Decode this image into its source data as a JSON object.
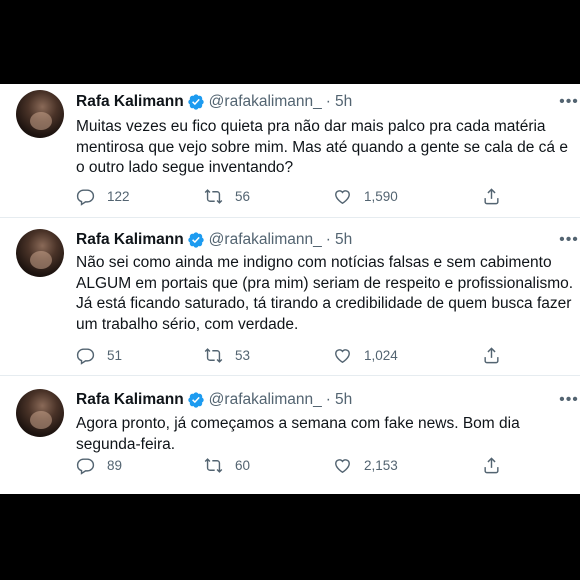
{
  "tweets": [
    {
      "name": "Rafa Kalimann",
      "handle": "@rafakalimann_",
      "sep": "·",
      "time": "5h",
      "text": "Muitas vezes eu fico quieta pra não dar mais palco pra cada matéria mentirosa que vejo sobre mim. Mas até quando a gente se cala de cá e o outro lado segue inventando?",
      "replies": "122",
      "retweets": "56",
      "likes": "1,590"
    },
    {
      "name": "Rafa Kalimann",
      "handle": "@rafakalimann_",
      "sep": "·",
      "time": "5h",
      "text": "Não sei como ainda me indigno com notícias falsas e sem cabimento ALGUM em portais que (pra mim) seriam de respeito e profissionalismo. Já está ficando saturado, tá tirando a credibilidade de quem busca fazer um trabalho sério, com verdade.",
      "replies": "51",
      "retweets": "53",
      "likes": "1,024"
    },
    {
      "name": "Rafa Kalimann",
      "handle": "@rafakalimann_",
      "sep": "·",
      "time": "5h",
      "text": "Agora pronto, já começamos a semana com fake news. Bom dia segunda-feira.",
      "replies": "89",
      "retweets": "60",
      "likes": "2,153"
    }
  ],
  "colors": {
    "verified": "#1d9bf0",
    "muted": "#536471",
    "text": "#0f1419"
  },
  "icons": [
    "verified-badge-icon",
    "more-icon",
    "reply-icon",
    "retweet-icon",
    "like-icon",
    "share-icon"
  ]
}
